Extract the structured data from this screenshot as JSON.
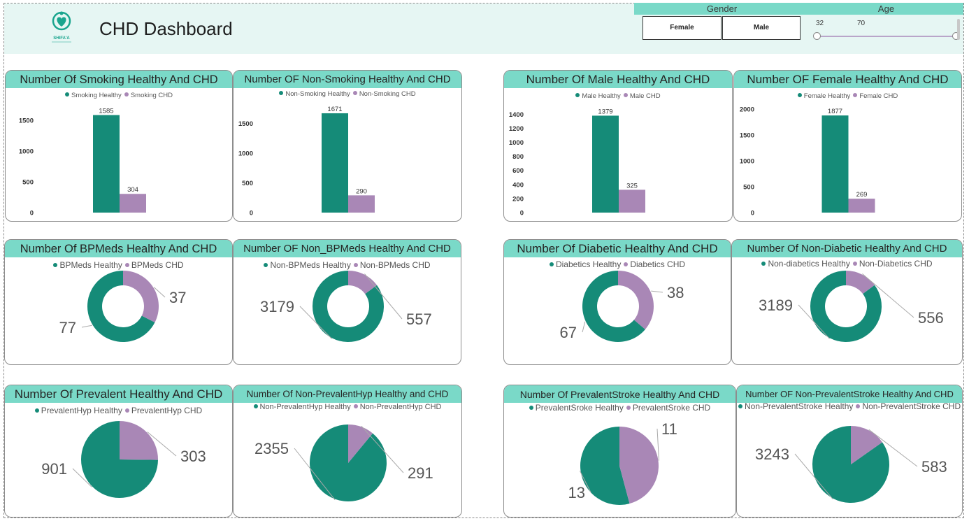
{
  "dashboard": {
    "title": "CHD Dashboard",
    "logo_text": "SHIFA'A"
  },
  "colors": {
    "healthy": "#158b78",
    "chd": "#a987b6",
    "title_bar": "#7ad9c8",
    "header_bg": "#e6f6f3"
  },
  "slicers": {
    "gender": {
      "label": "Gender",
      "options": [
        "Female",
        "Male"
      ]
    },
    "age": {
      "label": "Age",
      "min": "32",
      "max": "70"
    }
  },
  "chart_data": [
    {
      "id": "smoking",
      "type": "bar",
      "title": "Number Of Smoking Healthy And CHD",
      "categories": [
        "Smoking Healthy",
        "Smoking CHD"
      ],
      "values": [
        1585,
        304
      ],
      "legend": [
        "Smoking Healthy",
        "Smoking CHD"
      ],
      "ticks": [
        "0",
        "500",
        "1000",
        "1500"
      ],
      "tick_values": [
        0,
        500,
        1000,
        1500
      ],
      "data_labels": [
        "1585",
        "304"
      ]
    },
    {
      "id": "nonsmoking",
      "type": "bar",
      "title": "Number OF Non-Smoking Healthy And CHD",
      "categories": [
        "Non-Smoking Healthy",
        "Non-Smoking CHD"
      ],
      "values": [
        1671,
        290
      ],
      "legend": [
        "Non-Smoking Healthy",
        "Non-Smoking CHD"
      ],
      "ticks": [
        "0",
        "500",
        "1000",
        "1500"
      ],
      "tick_values": [
        0,
        500,
        1000,
        1500
      ],
      "data_labels": [
        "1671",
        "290"
      ]
    },
    {
      "id": "male",
      "type": "bar",
      "title": "Number Of Male Healthy And CHD",
      "categories": [
        "Male Healthy",
        "Male CHD"
      ],
      "values": [
        1379,
        325
      ],
      "legend": [
        "Male Healthy",
        "Male CHD"
      ],
      "ticks": [
        "0",
        "200",
        "400",
        "600",
        "800",
        "1000",
        "1200",
        "1400"
      ],
      "tick_values": [
        0,
        200,
        400,
        600,
        800,
        1000,
        1200,
        1400
      ],
      "data_labels": [
        "1379",
        "325"
      ]
    },
    {
      "id": "female",
      "type": "bar",
      "title": "Number OF Female Healthy And CHD",
      "categories": [
        "Female Healthy",
        "Female CHD"
      ],
      "values": [
        1877,
        269
      ],
      "legend": [
        "Female Healthy",
        "Female CHD"
      ],
      "ticks": [
        "0",
        "500",
        "1000",
        "1500",
        "2000"
      ],
      "tick_values": [
        0,
        500,
        1000,
        1500,
        2000
      ],
      "data_labels": [
        "1877",
        "269"
      ]
    },
    {
      "id": "bpmeds",
      "type": "pie",
      "donut": true,
      "title": "Number Of BPMeds Healthy And CHD",
      "categories": [
        "BPMeds Healthy",
        "BPMeds CHD"
      ],
      "values": [
        77,
        37
      ],
      "legend": [
        "BPMeds Healthy",
        "BPMeds CHD"
      ],
      "data_labels": [
        "77",
        "37"
      ]
    },
    {
      "id": "nonbpmeds",
      "type": "pie",
      "donut": true,
      "title": "Number OF Non_BPMeds Healthy And CHD",
      "categories": [
        "Non-BPMeds Healthy",
        "Non-BPMeds CHD"
      ],
      "values": [
        3179,
        557
      ],
      "legend": [
        "Non-BPMeds Healthy",
        "Non-BPMeds CHD"
      ],
      "data_labels": [
        "3179",
        "557"
      ]
    },
    {
      "id": "diabetic",
      "type": "pie",
      "donut": true,
      "title": "Number Of Diabetic Healthy And CHD",
      "categories": [
        "Diabetics Healthy",
        "Diabetics CHD"
      ],
      "values": [
        67,
        38
      ],
      "legend": [
        "Diabetics Healthy",
        "Diabetics CHD"
      ],
      "data_labels": [
        "67",
        "38"
      ]
    },
    {
      "id": "nondiabetic",
      "type": "pie",
      "donut": true,
      "title": "Number Of Non-Diabetic Healthy And CHD",
      "categories": [
        "Non-diabetics Healthy",
        "Non-Diabetics CHD"
      ],
      "values": [
        3189,
        556
      ],
      "legend": [
        "Non-diabetics Healthy",
        "Non-Diabetics CHD"
      ],
      "data_labels": [
        "3189",
        "556"
      ]
    },
    {
      "id": "prevalent",
      "type": "pie",
      "title": "Number Of Prevalent Healthy And CHD",
      "categories": [
        "PrevalentHyp Healthy",
        "PrevalentHyp CHD"
      ],
      "values": [
        901,
        303
      ],
      "legend": [
        "PrevalentHyp Healthy",
        "PrevalentHyp CHD"
      ],
      "data_labels": [
        "901",
        "303"
      ]
    },
    {
      "id": "nonprevalent",
      "type": "pie",
      "title": "Number Of Non-PrevalentHyp Healthy and CHD",
      "categories": [
        "Non-PrevalentHyp Healthy",
        "Non-PrevalentHyp CHD"
      ],
      "values": [
        2355,
        291
      ],
      "legend": [
        "Non-PrevalentHyp Healthy",
        "Non-PrevalentHyp CHD"
      ],
      "data_labels": [
        "2355",
        "291"
      ]
    },
    {
      "id": "stroke",
      "type": "pie",
      "title": "Number Of PrevalentStroke Healthy And CHD",
      "categories": [
        "PrevalentSroke Healthy",
        "PrevalentSroke CHD"
      ],
      "values": [
        13,
        11
      ],
      "legend": [
        "PrevalentSroke Healthy",
        "PrevalentSroke CHD"
      ],
      "data_labels": [
        "13",
        "11"
      ]
    },
    {
      "id": "nonstroke",
      "type": "pie",
      "title": "Number OF Non-PrevalentStroke Healthy And CHD",
      "categories": [
        "Non-PrevalentStroke Healthy",
        "Non-PrevalentStroke CHD"
      ],
      "values": [
        3243,
        583
      ],
      "legend": [
        "Non-PrevalentStroke Healthy",
        "Non-PrevalentStroke CHD"
      ],
      "data_labels": [
        "3243",
        "583"
      ]
    }
  ]
}
